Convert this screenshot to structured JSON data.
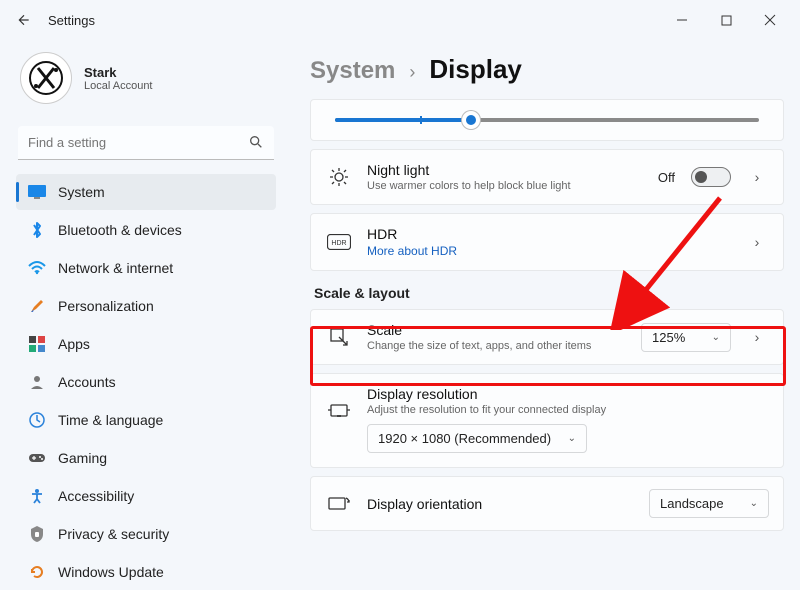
{
  "window": {
    "title": "Settings"
  },
  "profile": {
    "name": "Stark",
    "subtitle": "Local Account"
  },
  "search": {
    "placeholder": "Find a setting"
  },
  "nav": {
    "items": [
      {
        "label": "System"
      },
      {
        "label": "Bluetooth & devices"
      },
      {
        "label": "Network & internet"
      },
      {
        "label": "Personalization"
      },
      {
        "label": "Apps"
      },
      {
        "label": "Accounts"
      },
      {
        "label": "Time & language"
      },
      {
        "label": "Gaming"
      },
      {
        "label": "Accessibility"
      },
      {
        "label": "Privacy & security"
      },
      {
        "label": "Windows Update"
      }
    ]
  },
  "breadcrumb": {
    "parent": "System",
    "sep": "›",
    "current": "Display"
  },
  "brightness": {
    "value_percent": 32
  },
  "nightlight": {
    "title": "Night light",
    "subtitle": "Use warmer colors to help block blue light",
    "state_label": "Off"
  },
  "hdr": {
    "title": "HDR",
    "link": "More about HDR"
  },
  "section": {
    "scale_layout": "Scale & layout"
  },
  "scale": {
    "title": "Scale",
    "subtitle": "Change the size of text, apps, and other items",
    "value": "125%"
  },
  "resolution": {
    "title": "Display resolution",
    "subtitle": "Adjust the resolution to fit your connected display",
    "value": "1920 × 1080 (Recommended)"
  },
  "orientation": {
    "title": "Display orientation",
    "value": "Landscape"
  }
}
